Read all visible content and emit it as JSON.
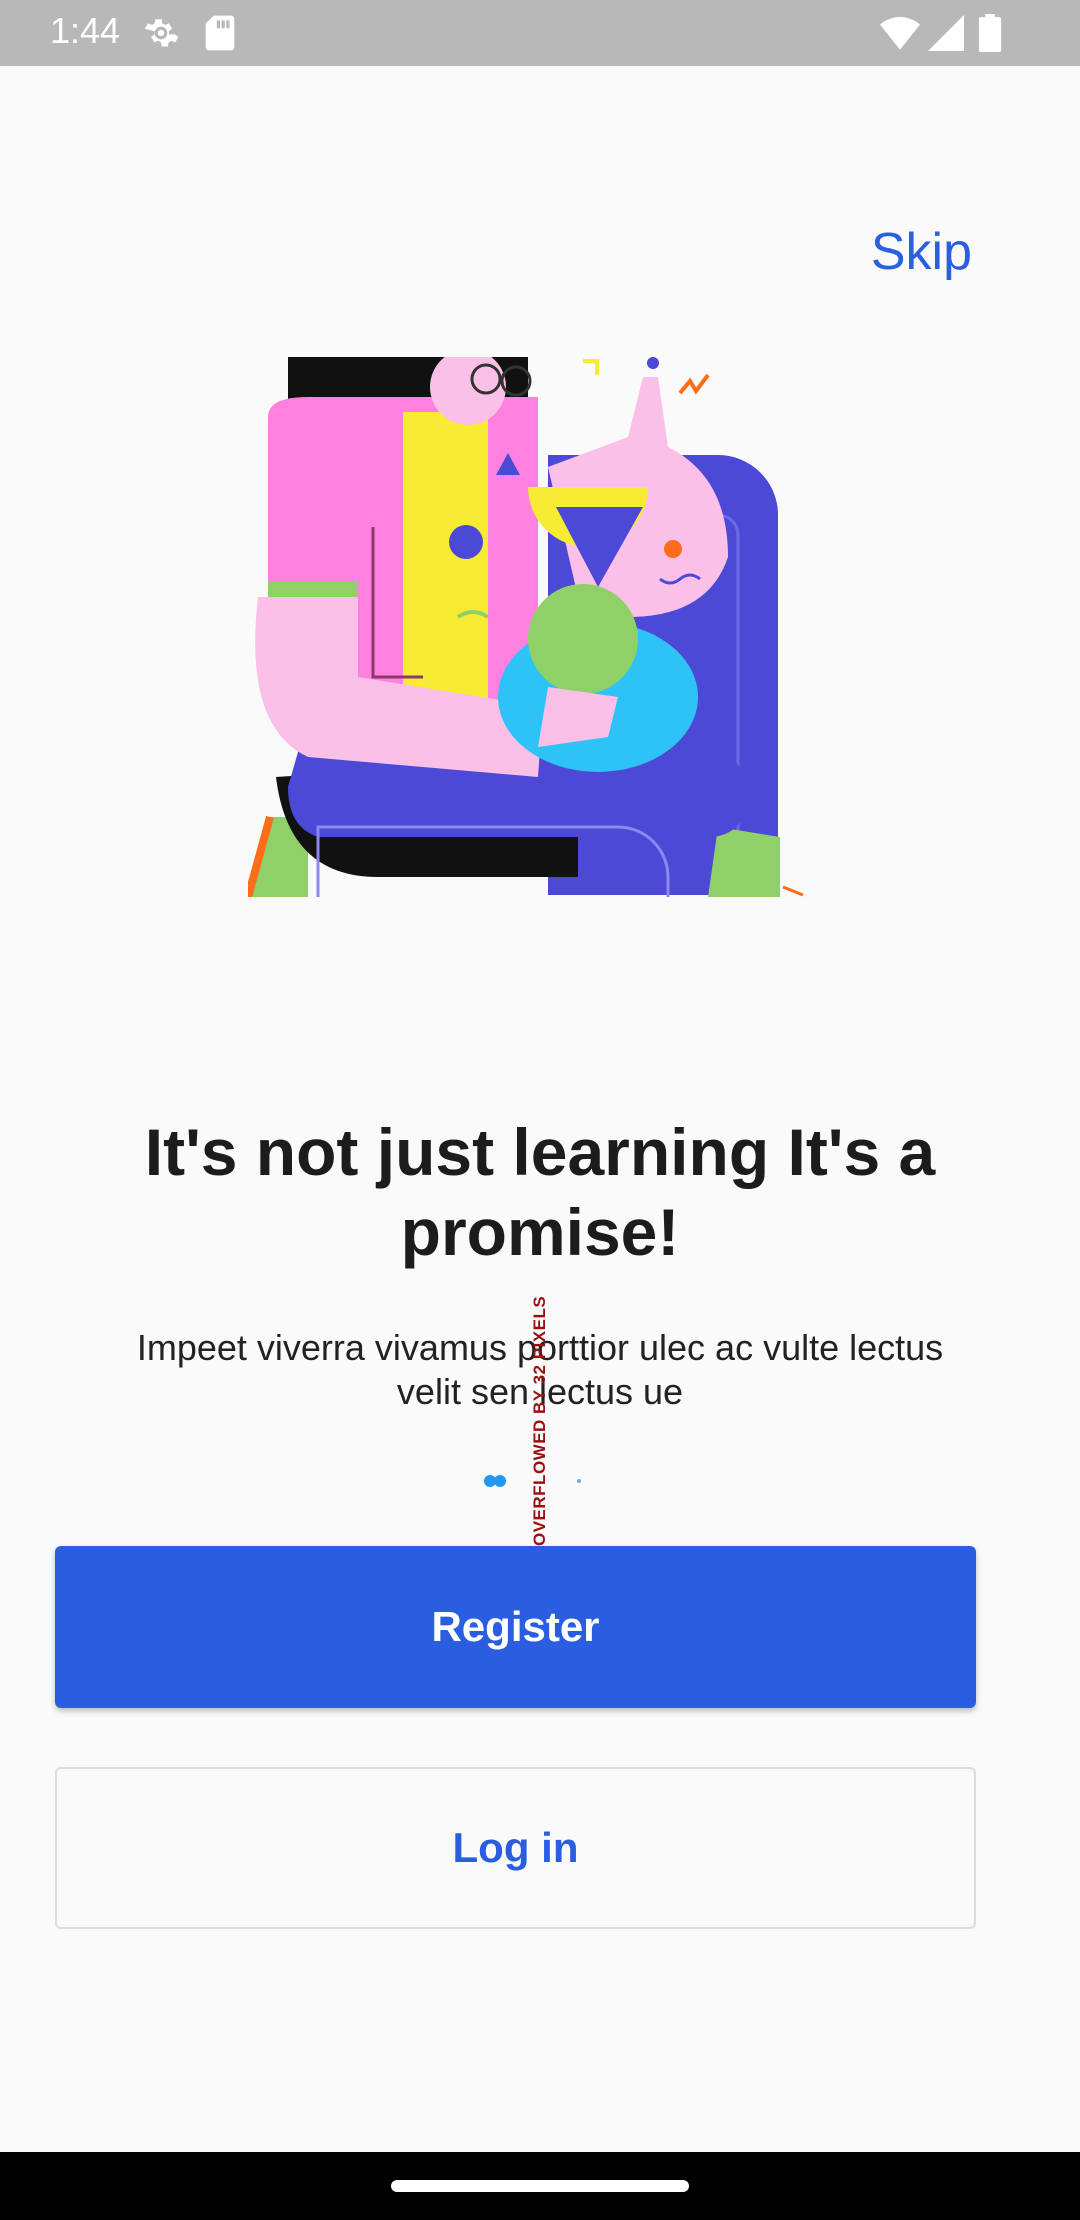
{
  "status_bar": {
    "time": "1:44",
    "icons_left": [
      "settings-icon",
      "sd-card-icon"
    ],
    "icons_right": [
      "wifi-icon",
      "signal-icon",
      "battery-icon"
    ]
  },
  "onboarding": {
    "skip_label": "Skip",
    "headline": "It's not just learning It's a promise!",
    "subtitle": "Impeet viverra vivamus porttior ulec ac vulte lectus velit sen lectus ue",
    "overflow_warning": "OVERFLOWED BY 32 PIXELS",
    "page_indicator": {
      "pages": 3,
      "current": 1
    }
  },
  "actions": {
    "register_label": "Register",
    "login_label": "Log in"
  },
  "colors": {
    "accent": "#2a5de0",
    "background": "#fafafa",
    "status_bar": "#b8b8b8"
  }
}
